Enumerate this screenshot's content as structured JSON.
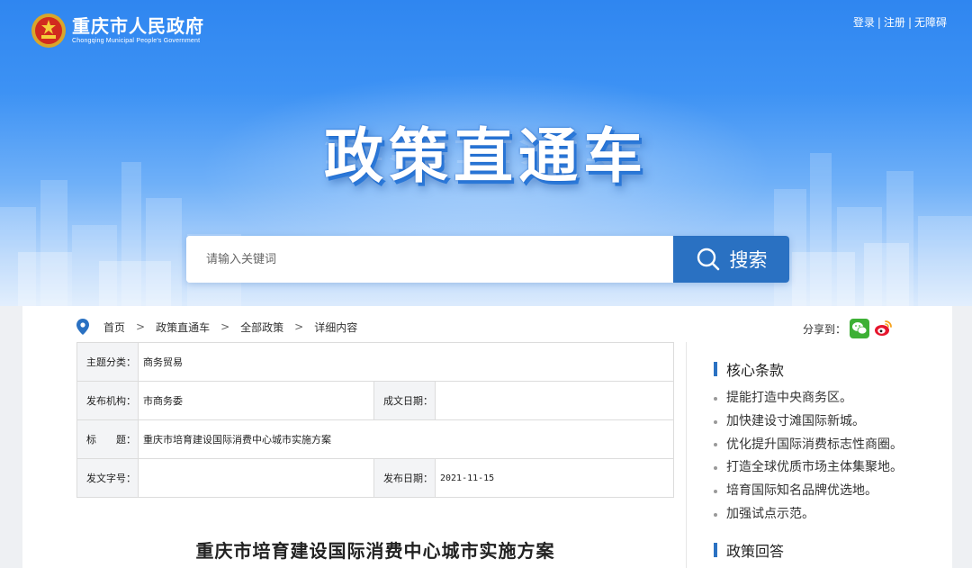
{
  "header": {
    "site_name_cn": "重庆市人民政府",
    "site_name_en": "Chongqing Municipal People's Government",
    "links": [
      "登录",
      "注册",
      "无障碍"
    ],
    "separator": "|"
  },
  "hero": {
    "title": "政策直通车"
  },
  "search": {
    "placeholder": "请输入关键词",
    "button_label": "搜索"
  },
  "breadcrumb": {
    "items": [
      "首页",
      "政策直通车",
      "全部政策",
      "详细内容"
    ],
    "separator": ">"
  },
  "share": {
    "label": "分享到：",
    "icons": [
      "wechat-icon",
      "weibo-icon"
    ]
  },
  "info": {
    "theme_label": "主题分类：",
    "theme_value": "商务贸易",
    "publisher_label": "发布机构：",
    "publisher_value": "市商务委",
    "written_date_label": "成文日期：",
    "written_date_value": "",
    "title_label": "标　　题：",
    "title_value": "重庆市培育建设国际消费中心城市实施方案",
    "doc_number_label": "发文字号：",
    "doc_number_value": "",
    "publish_date_label": "发布日期：",
    "publish_date_value": "2021-11-15"
  },
  "document": {
    "title": "重庆市培育建设国际消费中心城市实施方案"
  },
  "sidebar": {
    "core_heading": "核心条款",
    "core_items": [
      "提能打造中央商务区。",
      "加快建设寸滩国际新城。",
      "优化提升国际消费标志性商圈。",
      "打造全球优质市场主体集聚地。",
      "培育国际知名品牌优选地。",
      "加强试点示范。"
    ],
    "answer_heading": "政策回答"
  },
  "colors": {
    "primary": "#2a71c2",
    "banner_top": "#2f86f0",
    "banner_bottom": "#dcebfd",
    "wechat": "#3db035",
    "weibo": "#e6162d"
  }
}
